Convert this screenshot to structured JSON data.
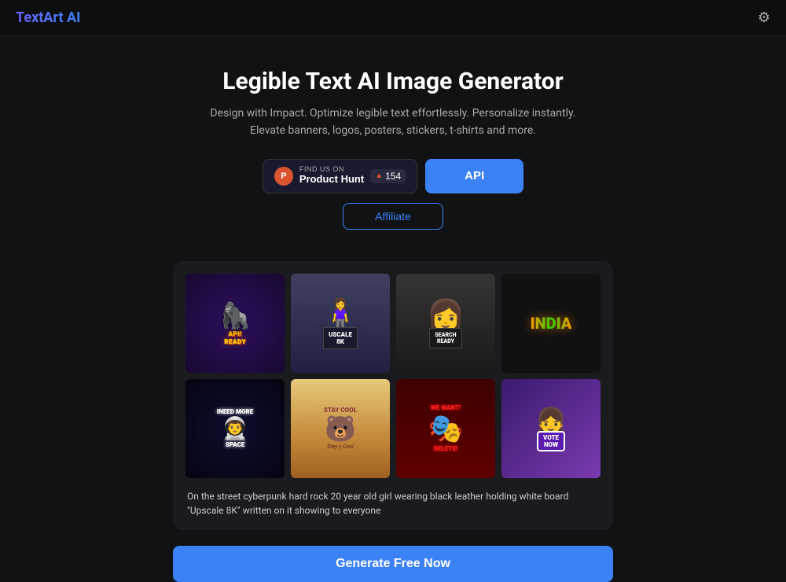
{
  "header": {
    "logo": "TextArt AI",
    "gear_label": "Settings"
  },
  "hero": {
    "title": "Legible Text AI Image Generator",
    "description": "Design with Impact. Optimize legible text effortlessly. Personalize instantly. Elevate banners, logos, posters, stickers, t-shirts and more.",
    "product_hunt_find_us": "FIND US ON",
    "product_hunt_name": "Product Hunt",
    "product_hunt_count": "154",
    "api_label": "API",
    "affiliate_label": "Affiliate"
  },
  "gallery": {
    "images": [
      {
        "id": "api-ready",
        "alt": "API Ready gorilla sticker"
      },
      {
        "id": "uscale-8k",
        "alt": "USCALE 8K girl holding sign"
      },
      {
        "id": "search-ready",
        "alt": "Search Ready girl holding sign"
      },
      {
        "id": "india",
        "alt": "INDIA colorful graffiti text"
      },
      {
        "id": "i-need-more-space",
        "alt": "I Need More Space astronaut"
      },
      {
        "id": "stay-cool",
        "alt": "Stay Cool bear sticker"
      },
      {
        "id": "we-want-delete",
        "alt": "We Want Delete! Deadpool"
      },
      {
        "id": "vote-now",
        "alt": "Vote Now animated character"
      }
    ],
    "description": "On the street cyberpunk hard rock 20 year old girl wearing black leather holding white board \"Upscale 8K\" written on it showing to everyone"
  },
  "footer": {
    "generate_label": "Generate Free Now"
  }
}
